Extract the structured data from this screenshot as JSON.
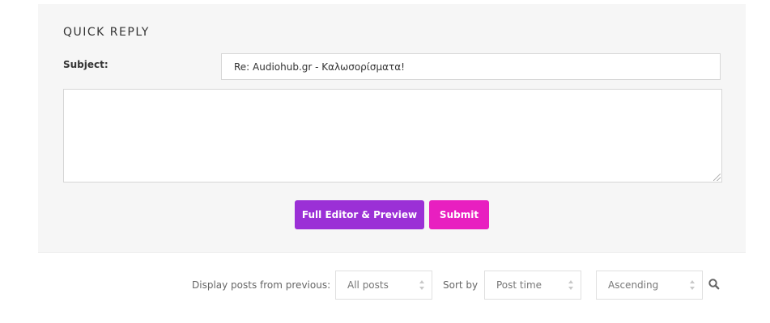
{
  "quick_reply": {
    "title": "QUICK REPLY",
    "subject_label": "Subject:",
    "subject_value": "Re: Audiohub.gr - Καλωσορίσματα!",
    "message_value": "",
    "full_editor_label": "Full Editor & Preview",
    "submit_label": "Submit"
  },
  "sort_bar": {
    "display_label": "Display posts from previous:",
    "display_selected": "All posts",
    "sort_by_label": "Sort by",
    "sort_by_selected": "Post time",
    "order_selected": "Ascending",
    "search_icon": "search-icon"
  },
  "colors": {
    "full_editor_button": "#9b30d6",
    "submit_button": "#e81fc0",
    "panel_background": "#f6f6f6"
  }
}
